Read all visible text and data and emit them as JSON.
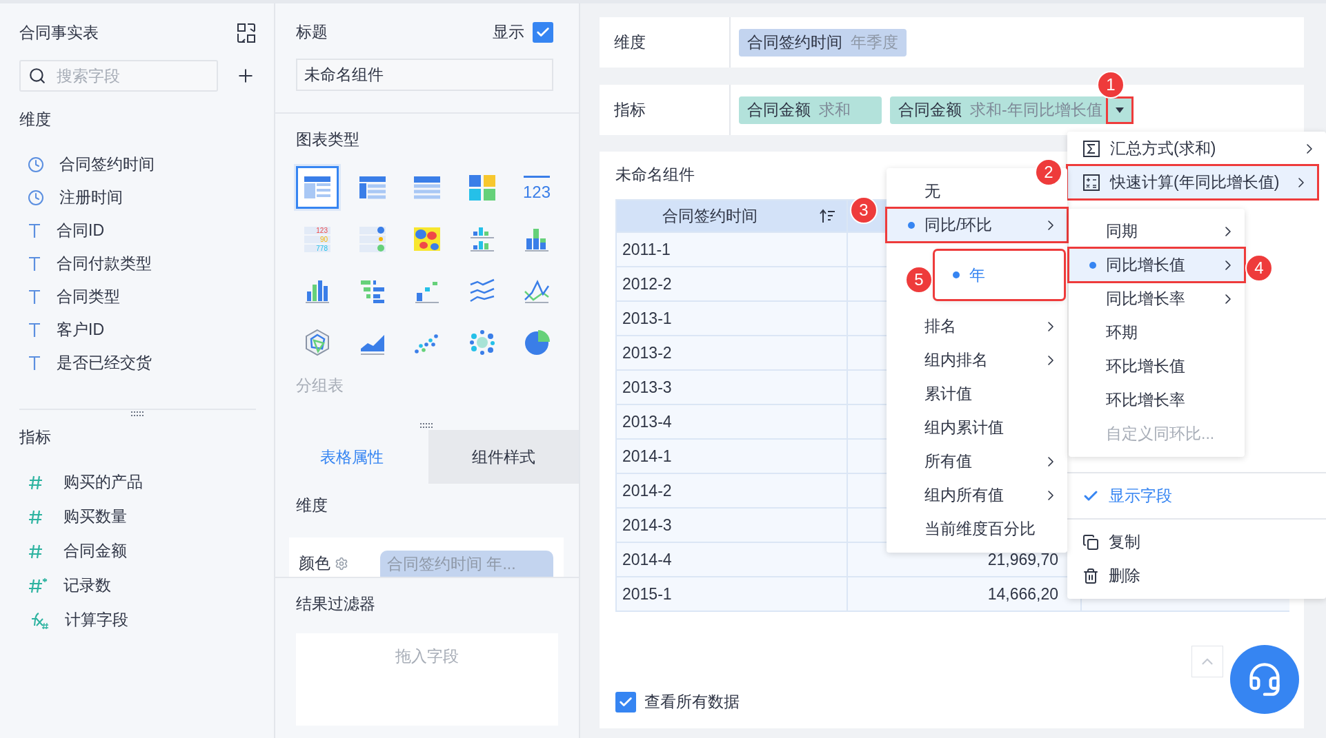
{
  "left_panel": {
    "title": "合同事实表",
    "search": {
      "placeholder": "搜索字段"
    },
    "dimensions": {
      "title": "维度",
      "fields": [
        {
          "kind": "time",
          "label": "合同签约时间"
        },
        {
          "kind": "time",
          "label": "注册时间"
        },
        {
          "kind": "text",
          "label": "合同ID"
        },
        {
          "kind": "text",
          "label": "合同付款类型"
        },
        {
          "kind": "text",
          "label": "合同类型"
        },
        {
          "kind": "text",
          "label": "客户ID"
        },
        {
          "kind": "text",
          "label": "是否已经交货"
        }
      ]
    },
    "measures": {
      "title": "指标",
      "fields": [
        {
          "kind": "number",
          "label": "购买的产品"
        },
        {
          "kind": "number",
          "label": "购买数量"
        },
        {
          "kind": "number",
          "label": "合同金额"
        },
        {
          "kind": "count",
          "label": "记录数"
        },
        {
          "kind": "formula",
          "label": "计算字段"
        }
      ]
    }
  },
  "mid_panel": {
    "title_label": "标题",
    "show_label": "显示",
    "show_checked": true,
    "title_value": "未命名组件",
    "chart_type_label": "图表类型",
    "chart_types": [
      {
        "kind": "group-table",
        "selected": true
      },
      {
        "kind": "cross-table",
        "selected": false
      },
      {
        "kind": "detail-table",
        "selected": false
      },
      {
        "kind": "blocks",
        "selected": false
      },
      {
        "kind": "number",
        "selected": false,
        "texts": [
          "123"
        ]
      },
      {
        "kind": "number-list",
        "selected": false,
        "texts": [
          "123",
          "90",
          "778"
        ]
      },
      {
        "kind": "dot-list",
        "selected": false
      },
      {
        "kind": "heatmap",
        "selected": false
      },
      {
        "kind": "grouped-bar",
        "selected": false
      },
      {
        "kind": "stacked-bar",
        "selected": false
      },
      {
        "kind": "bar",
        "selected": false
      },
      {
        "kind": "range-bar",
        "selected": false
      },
      {
        "kind": "step",
        "selected": false
      },
      {
        "kind": "multi-line",
        "selected": false
      },
      {
        "kind": "line-cross",
        "selected": false
      },
      {
        "kind": "radar",
        "selected": false
      },
      {
        "kind": "area",
        "selected": false
      },
      {
        "kind": "scatter",
        "selected": false
      },
      {
        "kind": "bubble",
        "selected": false
      },
      {
        "kind": "pie",
        "selected": false
      }
    ],
    "chart_type_name": "分组表",
    "tabs": [
      {
        "label": "表格属性",
        "selected": true
      },
      {
        "label": "组件样式",
        "selected": false
      }
    ],
    "dimension_label": "维度",
    "color_label": "颜色",
    "color_chip": "合同签约时间 年...",
    "filter_label": "结果过滤器",
    "filter_placeholder": "拖入字段"
  },
  "right_panel": {
    "dimension": {
      "label": "维度",
      "chips": [
        {
          "name": "合同签约时间",
          "detail": "年季度"
        }
      ]
    },
    "measure": {
      "label": "指标",
      "chips": [
        {
          "name": "合同金额",
          "detail": "求和",
          "dropdown": false
        },
        {
          "name": "合同金额",
          "detail": "求和-年同比增长值",
          "dropdown": true,
          "highlighted": true
        }
      ]
    },
    "widget": {
      "title": "未命名组件",
      "table": {
        "columns": [
          "合同签约时间"
        ],
        "rows": [
          {
            "cells": [
              "2011-1"
            ]
          },
          {
            "cells": [
              "2012-2"
            ]
          },
          {
            "cells": [
              "2013-1"
            ]
          },
          {
            "cells": [
              "2013-2"
            ]
          },
          {
            "cells": [
              "2013-3"
            ]
          },
          {
            "cells": [
              "2013-4"
            ]
          },
          {
            "cells": [
              "2014-1"
            ]
          },
          {
            "cells": [
              "2014-2"
            ]
          },
          {
            "cells": [
              "2014-3"
            ]
          },
          {
            "cells": [
              "2014-4",
              "21,969,70"
            ]
          },
          {
            "cells": [
              "2015-1",
              "14,666,20"
            ]
          }
        ]
      },
      "view_all": {
        "label": "查看所有数据",
        "checked": true
      }
    }
  },
  "field_menu": {
    "items": [
      {
        "kind": "summary",
        "label": "汇总方式(求和)",
        "submenu": true,
        "highlighted": false
      },
      {
        "kind": "quick-calc",
        "label": "快速计算(年同比增长值)",
        "submenu": true,
        "highlighted": true
      },
      {
        "kind": "covered"
      },
      {
        "kind": "divider"
      },
      {
        "kind": "check",
        "label": "显示字段",
        "checked": true
      },
      {
        "kind": "divider"
      },
      {
        "kind": "copy",
        "label": "复制",
        "submenu": false,
        "highlighted": false
      },
      {
        "kind": "delete",
        "label": "删除",
        "submenu": false,
        "highlighted": false
      }
    ]
  },
  "quick_calc_menu": {
    "items": [
      {
        "kind": "option",
        "label": "无",
        "selected": false,
        "submenu": false,
        "highlighted": false
      },
      {
        "kind": "option",
        "label": "同比/环比",
        "selected": true,
        "submenu": true,
        "highlighted": true
      },
      {
        "kind": "covered"
      },
      {
        "kind": "covered"
      },
      {
        "kind": "option",
        "label": "排名",
        "selected": false,
        "submenu": true,
        "highlighted": false
      },
      {
        "kind": "option",
        "label": "组内排名",
        "selected": false,
        "submenu": true,
        "highlighted": false
      },
      {
        "kind": "option",
        "label": "累计值",
        "selected": false,
        "submenu": false,
        "highlighted": false
      },
      {
        "kind": "option",
        "label": "组内累计值",
        "selected": false,
        "submenu": false,
        "highlighted": false
      },
      {
        "kind": "option",
        "label": "所有值",
        "selected": false,
        "submenu": true,
        "highlighted": false
      },
      {
        "kind": "option",
        "label": "组内所有值",
        "selected": false,
        "submenu": true,
        "highlighted": false
      },
      {
        "kind": "option",
        "label": "当前维度百分比",
        "selected": false,
        "submenu": false,
        "highlighted": false
      }
    ]
  },
  "period_menu": {
    "items": [
      {
        "kind": "option",
        "label": "同期",
        "selected": false,
        "submenu": true,
        "highlighted": false,
        "disabled": false
      },
      {
        "kind": "option",
        "label": "同比增长值",
        "selected": true,
        "submenu": true,
        "highlighted": true,
        "disabled": false
      },
      {
        "kind": "option",
        "label": "同比增长率",
        "selected": false,
        "submenu": true,
        "highlighted": false,
        "disabled": false
      },
      {
        "kind": "option",
        "label": "环期",
        "selected": false,
        "submenu": false,
        "highlighted": false,
        "disabled": false
      },
      {
        "kind": "option",
        "label": "环比增长值",
        "selected": false,
        "submenu": false,
        "highlighted": false,
        "disabled": false
      },
      {
        "kind": "option",
        "label": "环比增长率",
        "selected": false,
        "submenu": false,
        "highlighted": false,
        "disabled": false
      },
      {
        "kind": "option",
        "label": "自定义同环比...",
        "selected": false,
        "submenu": false,
        "highlighted": false,
        "disabled": true
      }
    ]
  },
  "year_menu": {
    "highlighted": true,
    "items": [
      {
        "kind": "option",
        "label": "年",
        "selected": true
      }
    ]
  },
  "callouts": [
    "1",
    "2",
    "3",
    "4",
    "5"
  ]
}
